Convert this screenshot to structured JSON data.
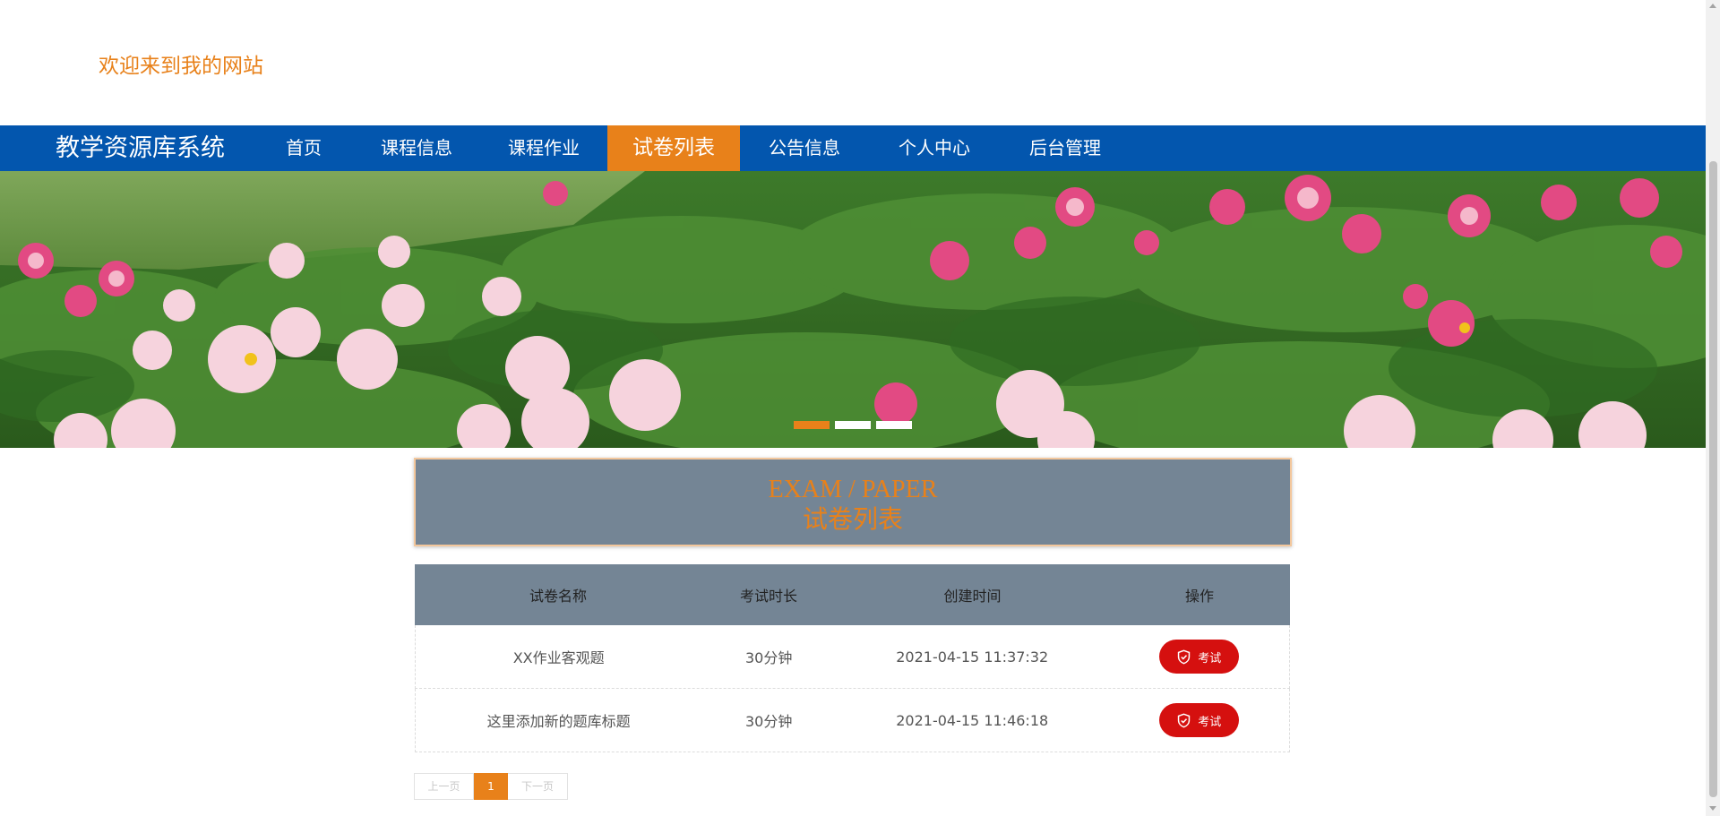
{
  "header": {
    "welcome_text": "欢迎来到我的网站"
  },
  "nav": {
    "brand": "教学资源库系统",
    "items": [
      {
        "label": "首页",
        "active": false
      },
      {
        "label": "课程信息",
        "active": false
      },
      {
        "label": "课程作业",
        "active": false
      },
      {
        "label": "试卷列表",
        "active": true
      },
      {
        "label": "公告信息",
        "active": false
      },
      {
        "label": "个人中心",
        "active": false
      },
      {
        "label": "后台管理",
        "active": false
      }
    ]
  },
  "banner": {
    "slide_count": 3,
    "active_slide": 1
  },
  "section": {
    "title_en": "EXAM / PAPER",
    "title_cn": "试卷列表"
  },
  "table": {
    "headers": [
      "试卷名称",
      "考试时长",
      "创建时间",
      "操作"
    ],
    "rows": [
      {
        "name": "XX作业客观题",
        "duration": "30分钟",
        "created": "2021-04-15 11:37:32",
        "action": "考试"
      },
      {
        "name": "这里添加新的题库标题",
        "duration": "30分钟",
        "created": "2021-04-15 11:46:18",
        "action": "考试"
      }
    ]
  },
  "pagination": {
    "prev": "上一页",
    "current": "1",
    "next": "下一页"
  },
  "colors": {
    "accent": "#e8811a",
    "nav_bg": "#0356ae",
    "header_gray": "#748595",
    "exam_red": "#d5100f"
  }
}
